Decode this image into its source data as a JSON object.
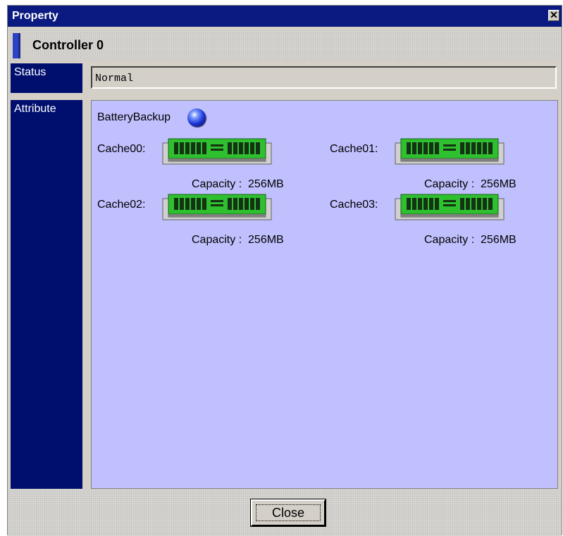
{
  "window": {
    "title": "Property",
    "close_glyph": "✕"
  },
  "header": {
    "title": "Controller 0"
  },
  "status": {
    "label": "Status",
    "value": "Normal"
  },
  "attribute": {
    "label": "Attribute",
    "battery_label": "BatteryBackup",
    "battery_icon": "blue-sphere-icon",
    "caches": [
      {
        "name": "Cache00:",
        "capacity_label": "Capacity :",
        "capacity_value": "256MB"
      },
      {
        "name": "Cache01:",
        "capacity_label": "Capacity :",
        "capacity_value": "256MB"
      },
      {
        "name": "Cache02:",
        "capacity_label": "Capacity :",
        "capacity_value": "256MB"
      },
      {
        "name": "Cache03:",
        "capacity_label": "Capacity :",
        "capacity_value": "256MB"
      }
    ]
  },
  "footer": {
    "close_label": "Close"
  },
  "colors": {
    "titlebar": "#0a1a80",
    "label_column": "#000e6e",
    "panel": "#c0c0ff",
    "memory_green": "#2fc02f"
  }
}
